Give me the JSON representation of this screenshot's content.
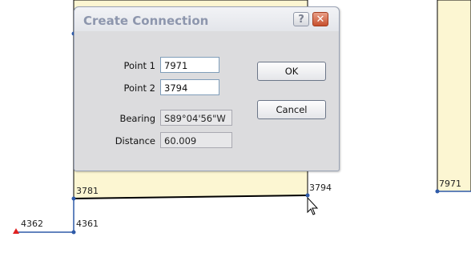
{
  "dialog": {
    "title": "Create Connection",
    "help_glyph": "?",
    "close_glyph": "✕",
    "fields": {
      "point1": {
        "label": "Point 1",
        "value": "7971"
      },
      "point2": {
        "label": "Point 2",
        "value": "3794"
      },
      "bearing": {
        "label": "Bearing",
        "value": "S89°04'56\"W"
      },
      "distance": {
        "label": "Distance",
        "value": "60.009"
      }
    },
    "ok_label": "OK",
    "cancel_label": "Cancel"
  },
  "map": {
    "parcel_fill": "#fcf6d2",
    "line_color": "#2e5aa8",
    "point_labels": [
      "3781",
      "3794",
      "7971",
      "4362",
      "4361"
    ]
  }
}
